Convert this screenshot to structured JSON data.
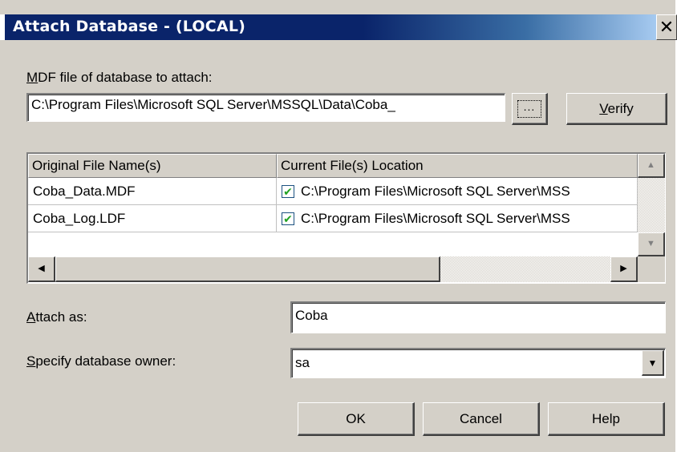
{
  "window": {
    "title": "Attach Database - (LOCAL)",
    "close_glyph": "✕"
  },
  "mdf": {
    "label_key": "M",
    "label_rest": "DF file of database to attach:",
    "value": "C:\\Program Files\\Microsoft SQL Server\\MSSQL\\Data\\Coba_",
    "browse_label": "...",
    "verify_key": "V",
    "verify_rest": "erify"
  },
  "files_table": {
    "columns": [
      "Original File Name(s)",
      "Current File(s) Location"
    ],
    "rows": [
      {
        "original": "Coba_Data.MDF",
        "checked": true,
        "location": "C:\\Program Files\\Microsoft SQL Server\\MSS"
      },
      {
        "original": "Coba_Log.LDF",
        "checked": true,
        "location": "C:\\Program Files\\Microsoft SQL Server\\MSS"
      }
    ],
    "check_glyph": "✔"
  },
  "attach_as": {
    "label_key": "A",
    "label_rest": "ttach as:",
    "value": "Coba"
  },
  "owner": {
    "label_key": "S",
    "label_rest": "pecify database owner:",
    "value": "sa"
  },
  "buttons": {
    "ok": "OK",
    "cancel": "Cancel",
    "help": "Help"
  },
  "icons": {
    "scroll_up": "arrow-up-icon",
    "scroll_down": "arrow-down-icon",
    "scroll_left": "arrow-left-icon",
    "scroll_right": "arrow-right-icon",
    "combo": "dropdown-arrow-icon"
  },
  "colors": {
    "title_bar": "#0a246a",
    "face": "#d4d0c8",
    "check": "#21a121"
  }
}
